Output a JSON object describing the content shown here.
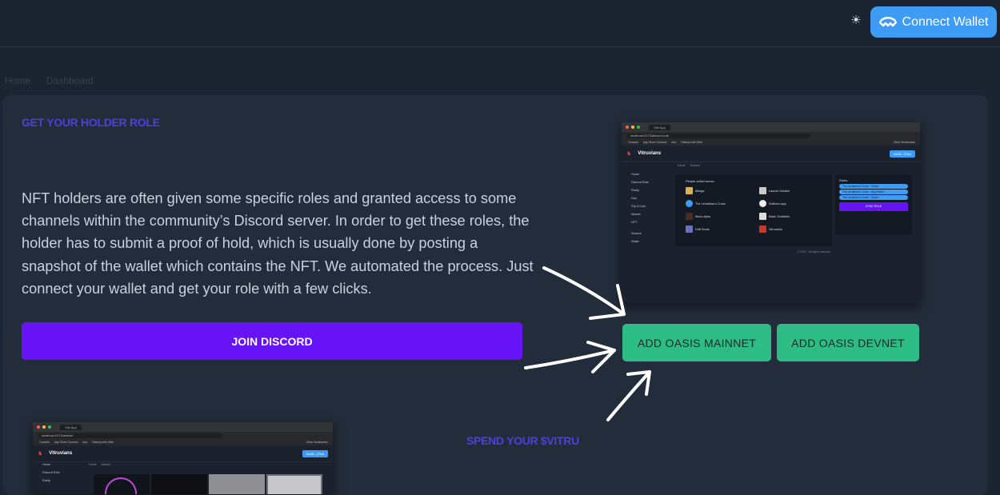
{
  "header": {
    "theme_icon": "sun-icon",
    "connect_wallet_label": "Connect Wallet",
    "connect_wallet_icon": "walletconnect-icon"
  },
  "breadcrumb": [
    "Home",
    "Dashboard"
  ],
  "holder_section": {
    "title": "GET YOUR HOLDER ROLE",
    "description": "NFT holders are often given some specific roles and granted access to some channels within the community’s Discord server. In order to get these roles, the holder has to submit a proof of hold, which is usually done by posting a snapshot of the wallet which contains the NFT. We automated the process. Just connect your wallet and get your role with a few clicks.",
    "join_discord_label": "JOIN DISCORD",
    "add_mainnet_label": "ADD OASIS MAINNET",
    "add_devnet_label": "ADD OASIS DEVNET"
  },
  "spend_section": {
    "title": "SPEND YOUR $VITRU"
  },
  "preview_main": {
    "tab": "Vite App",
    "url": "localhost:3173/discord-role",
    "bookmarks": [
      "Console",
      "App Store Connect",
      "ubo",
      "Startup with Web",
      "Other Bookmarks"
    ],
    "app_title": "Vitruvians",
    "wallet_button": "0xG8...27bA",
    "sidebar": [
      "Home",
      "Discord Role",
      "Rarity",
      "Dao",
      "Flip A Coin",
      "Market",
      "NFT",
      "Season",
      "Stake"
    ],
    "breadcrumb": [
      "Home",
      "Discord"
    ],
    "servers_title": "Please select server",
    "servers": [
      "Mirage",
      "Launch Garden",
      "The Leviathan's Curse",
      "Sollicers app",
      "Moon Apes",
      "Basic Scribbles",
      "Drift Souls",
      "Vitruvians"
    ],
    "roles_title": "Roles",
    "roles": [
      "The Leviathan's Curse · Holder",
      "The Leviathan's Curse · Bag Holder",
      "The Leviathan's Curse · Sniper"
    ],
    "sync_label": "SYNC ROLE",
    "footer": "© 2022 - All rights reserved"
  },
  "preview_second": {
    "tab": "Vite App",
    "url": "localhost:3173/market",
    "bookmarks": [
      "Console",
      "App Store Connect",
      "ubo",
      "Startup with Web",
      "Other Bookmarks"
    ],
    "app_title": "Vitruvians",
    "wallet_button": "0xG8...27bA",
    "sidebar": [
      "Home",
      "Discord Role",
      "Rarity"
    ],
    "breadcrumb": [
      "Home",
      "Market"
    ]
  },
  "colors": {
    "background": "#1c2431",
    "card": "#232c3a",
    "accent_blue": "#3e9cf5",
    "discord_purple": "#6613f5",
    "oasis_green": "#2dbb86",
    "title_indigo": "#4c3fe0"
  }
}
